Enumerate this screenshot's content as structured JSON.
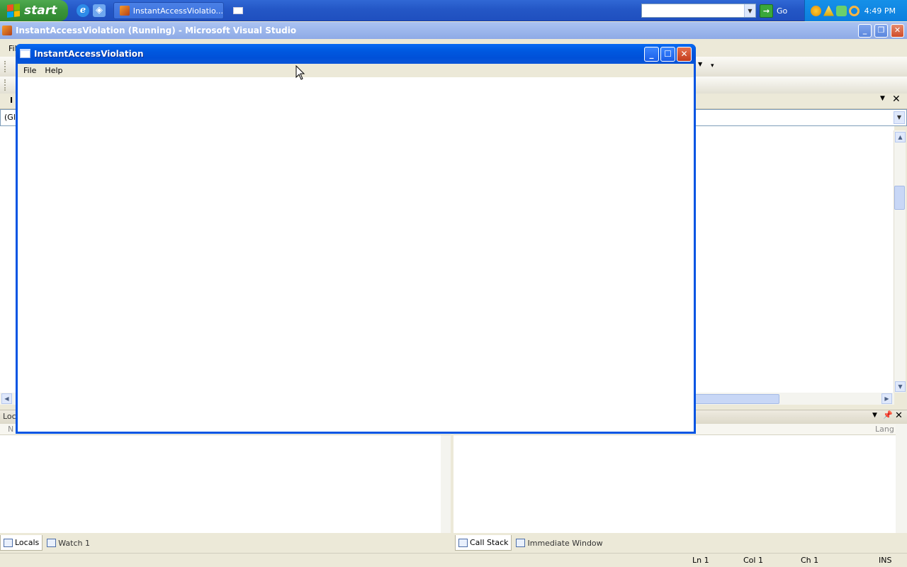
{
  "taskbar": {
    "start_label": "start",
    "task_button_label": "InstantAccessViolatio...",
    "search_placeholder": "",
    "go_label": "Go",
    "clock": "4:49 PM"
  },
  "vs": {
    "title": "InstantAccessViolation (Running) - Microsoft Visual Studio",
    "menu_fragment": "Fil",
    "doc_tab_fragment": "I",
    "dropdown_fragment": "(Glo",
    "lower_panel_fragment": "Loca",
    "lower_col_left": "N",
    "lower_col_right": "Lang",
    "left_tabs": [
      "Locals",
      "Watch 1"
    ],
    "right_tabs": [
      "Call Stack",
      "Immediate Window"
    ],
    "status": {
      "ln": "Ln 1",
      "col": "Col 1",
      "ch": "Ch 1",
      "mode": "INS"
    }
  },
  "app": {
    "title": "InstantAccessViolation",
    "menus": [
      "File",
      "Help"
    ]
  },
  "colors": {
    "xp_blue": "#0054e3",
    "taskbar_blue": "#2457c6",
    "start_green": "#3a943a",
    "tray_blue": "#0c7fde",
    "face": "#ece9d8"
  }
}
